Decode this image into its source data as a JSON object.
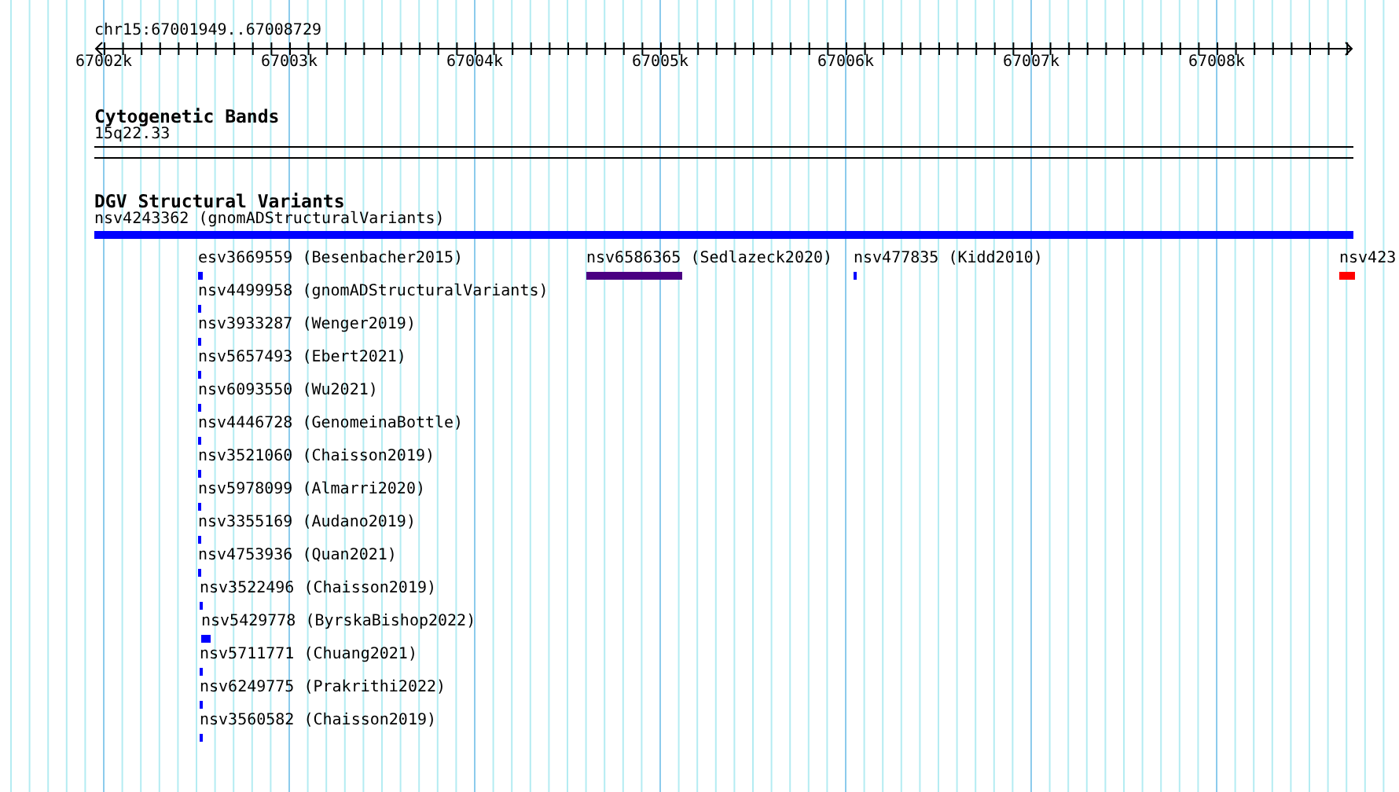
{
  "ruler": {
    "location": "chr15:67001949..67008729",
    "ticks": [
      "67002k",
      "67003k",
      "67004k",
      "67005k",
      "67006k",
      "67007k",
      "67008k"
    ]
  },
  "tracks": [
    {
      "kind": "cytobands",
      "title": "Cytogenetic Bands",
      "label": "15q22.33"
    },
    {
      "kind": "variants",
      "title": "DGV Structural Variants",
      "rows": [
        [
          {
            "label": "nsv4243362 (gnomADStructuralVariants)",
            "color": "#0000ff"
          }
        ],
        [
          {
            "label": "esv3669559 (Besenbacher2015)",
            "color": "#0000ff"
          },
          {
            "label": "nsv6586365 (Sedlazeck2020)",
            "color": "#4b0082"
          },
          {
            "label": "nsv477835 (Kidd2010)",
            "color": "#0000ff"
          },
          {
            "label": "nsv423",
            "color": "#ff0000"
          }
        ],
        [
          {
            "label": "nsv4499958 (gnomADStructuralVariants)",
            "color": "#0000ff"
          }
        ],
        [
          {
            "label": "nsv3933287 (Wenger2019)",
            "color": "#0000ff"
          }
        ],
        [
          {
            "label": "nsv5657493 (Ebert2021)",
            "color": "#0000ff"
          }
        ],
        [
          {
            "label": "nsv6093550 (Wu2021)",
            "color": "#0000ff"
          }
        ],
        [
          {
            "label": "nsv4446728 (GenomeinaBottle)",
            "color": "#0000ff"
          }
        ],
        [
          {
            "label": "nsv3521060 (Chaisson2019)",
            "color": "#0000ff"
          }
        ],
        [
          {
            "label": "nsv5978099 (Almarri2020)",
            "color": "#0000ff"
          }
        ],
        [
          {
            "label": "nsv3355169 (Audano2019)",
            "color": "#0000ff"
          }
        ],
        [
          {
            "label": "nsv4753936 (Quan2021)",
            "color": "#0000ff"
          }
        ],
        [
          {
            "label": "nsv3522496 (Chaisson2019)",
            "color": "#0000ff"
          }
        ],
        [
          {
            "label": "nsv5429778 (ByrskaBishop2022)",
            "color": "#0000ff"
          }
        ],
        [
          {
            "label": "nsv5711771 (Chuang2021)",
            "color": "#0000ff"
          }
        ],
        [
          {
            "label": "nsv6249775 (Prakrithi2022)",
            "color": "#0000ff"
          }
        ],
        [
          {
            "label": "nsv3560582 (Chaisson2019)",
            "color": "#0000ff"
          }
        ]
      ]
    }
  ]
}
